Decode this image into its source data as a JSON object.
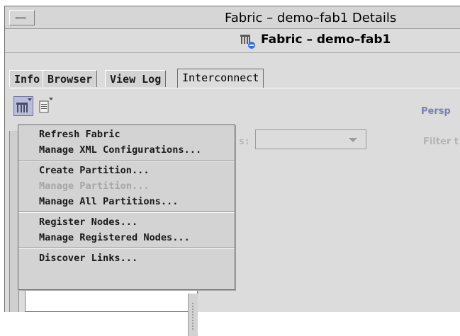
{
  "window": {
    "title": "Fabric – demo–fab1 Details"
  },
  "header": {
    "title": "Fabric – demo–fab1",
    "icon": "fabric-icon"
  },
  "tabs": [
    {
      "label": "Info"
    },
    {
      "label": "Browser"
    },
    {
      "label": "View Log"
    },
    {
      "label": "Interconnect",
      "active": true
    }
  ],
  "toolbar": {
    "fabric_menu_icon": "fabric-menu-icon",
    "document_menu_icon": "document-menu-icon",
    "perspective_label": "Persp"
  },
  "filter": {
    "partial_label": "s:",
    "select_value": "",
    "filter_label": "Filter t"
  },
  "menu": {
    "sections": [
      {
        "items": [
          {
            "label": "Refresh Fabric"
          },
          {
            "label": "Manage XML Configurations..."
          }
        ]
      },
      {
        "items": [
          {
            "label": "Create Partition..."
          },
          {
            "label": "Manage Partition...",
            "disabled": true
          },
          {
            "label": "Manage All Partitions..."
          }
        ]
      },
      {
        "items": [
          {
            "label": "Register Nodes..."
          },
          {
            "label": "Manage Registered Nodes..."
          }
        ]
      },
      {
        "items": [
          {
            "label": "Discover Links..."
          }
        ]
      }
    ]
  },
  "colors": {
    "accent": "#7b7fb3",
    "menu_bg": "#d3d3d3",
    "window_bg": "#dcdcdc"
  }
}
